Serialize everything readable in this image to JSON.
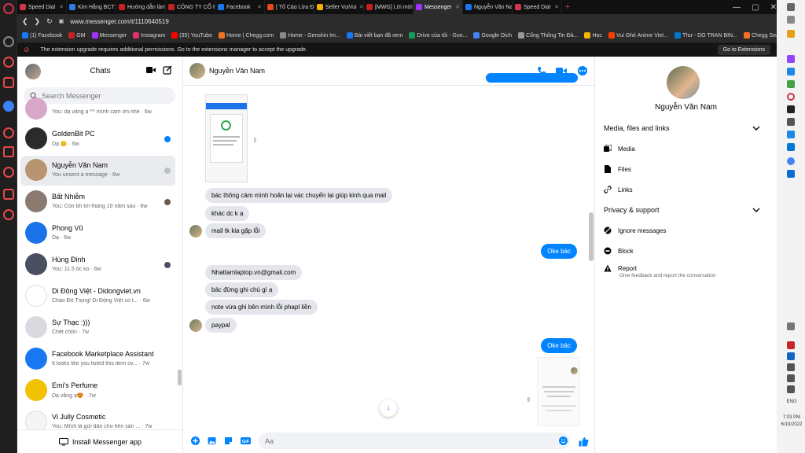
{
  "browser": {
    "tabs": [
      {
        "title": "Speed Dial",
        "color": "#d0354a"
      },
      {
        "title": "Kim Hằng BCT1",
        "color": "#2d7be5"
      },
      {
        "title": "Hướng dẫn làm",
        "color": "#c5221f"
      },
      {
        "title": "CÔNG TY CỔ PH",
        "color": "#c5221f"
      },
      {
        "title": "Facebook",
        "color": "#1877f2"
      },
      {
        "title": "[ Tố Cáo Lừa Đả",
        "color": "#e64a19"
      },
      {
        "title": "Seller VuiVui",
        "color": "#f5b300"
      },
      {
        "title": "[MWG] Lời mời l",
        "color": "#c5221f"
      },
      {
        "title": "Messenger",
        "color": "#a033ff",
        "active": true
      },
      {
        "title": "Nguyễn Văn Na",
        "color": "#1877f2"
      },
      {
        "title": "Speed Dial",
        "color": "#d0354a"
      }
    ],
    "new_tab": "+",
    "url": "www.messenger.com/t/1110640519",
    "bookmarks": [
      {
        "label": "(1) Facebook",
        "color": "#1877f2"
      },
      {
        "label": "GM",
        "color": "#c5221f"
      },
      {
        "label": "Messenger",
        "color": "#a033ff"
      },
      {
        "label": "Instagram",
        "color": "#e1306c"
      },
      {
        "label": "(35) YouTube",
        "color": "#ff0000"
      },
      {
        "label": "Home | Chegg.com",
        "color": "#f47321"
      },
      {
        "label": "Home - Genshin Im...",
        "color": "#888888"
      },
      {
        "label": "Bài viết bạn đã xem",
        "color": "#1877f2"
      },
      {
        "label": "Drive của tôi - Goo...",
        "color": "#0f9d58"
      },
      {
        "label": "Google Dịch",
        "color": "#4285f4"
      },
      {
        "label": "Cổng Thông Tin Đà...",
        "color": "#999999"
      },
      {
        "label": "Học",
        "color": "#f5b300"
      },
      {
        "label": "Vui Ghé Anime Viet...",
        "color": "#ff3d00"
      },
      {
        "label": "Thư - DO TRAN BIN...",
        "color": "#0078d4"
      },
      {
        "label": "Chegg Search",
        "color": "#f47321"
      }
    ],
    "notice": "The extension upgrade requires additional permissions. Go to the extensions manager to accept the upgrade.",
    "notice_button": "Go to Extensions"
  },
  "chats": {
    "title": "Chats",
    "search_placeholder": "Search Messenger",
    "items": [
      {
        "name": "",
        "snippet": "You: dạ vâng ạ ^^ mình cảm ơn nhé · 6w",
        "avatar": "#d9a7c7"
      },
      {
        "name": "GoldenBit PC",
        "snippet": "Dạ 😊 · 6w",
        "avatar": "#2b2b2b",
        "status": "#0084ff"
      },
      {
        "name": "Nguyễn Văn Nam",
        "snippet": "You unsent a message · 6w",
        "avatar": "#b89470",
        "status": "#bcc0c4"
      },
      {
        "name": "Bất Nhiễm",
        "snippet": "You: Còn bh tới tháng 10 nằm sau · 6w",
        "avatar": "#8a7a70",
        "status": "#6b5a50"
      },
      {
        "name": "Phong Vũ",
        "snippet": "Dạ · 6w",
        "avatar": "#1a73e8"
      },
      {
        "name": "Hùng Đinh",
        "snippet": "You: 11.5 ốc ko · 6w",
        "avatar": "#4a5060",
        "status": "#4a5060"
      },
      {
        "name": "Di Động Việt - Didongviet.vn",
        "snippet": "Chào Đỗ Trọng! Di Động Việt có t... · 6w",
        "avatar": "#ffffff"
      },
      {
        "name": "Sự Thạc :)))",
        "snippet": "Chết chôn · 7w",
        "avatar": "#d8dadf"
      },
      {
        "name": "Facebook Marketplace Assistant",
        "snippet": "It looks like you listed this item ov... · 7w",
        "avatar": "#1877f2"
      },
      {
        "name": "Emi's Perfume",
        "snippet": "Dạ vâng ạ😍 · 7w",
        "avatar": "#f2c200"
      },
      {
        "name": "Vi Jully Cosmetic",
        "snippet": "You: Mình là gửi dân cho hên sàn ... · 7w",
        "avatar": "#f5f5f5"
      }
    ],
    "install_label": "Install Messenger app"
  },
  "conversation": {
    "name": "Nguyễn Văn Nam",
    "messages": [
      {
        "dir": "in",
        "text": "bác thông cảm mình hoãn lại vác chuyển lại giúp kinh qua mail"
      },
      {
        "dir": "in",
        "text": "khác dc k ạ"
      },
      {
        "dir": "in",
        "text": "mail tk kia gặp lỗi"
      },
      {
        "dir": "out",
        "text": "Oke bác"
      },
      {
        "dir": "in",
        "text": "Nhattamlaptop.vn@gmail.com"
      },
      {
        "dir": "in",
        "text": "bác đừng ghi chú gì ạ"
      },
      {
        "dir": "in",
        "text": "note vừa ghi bên mình lỗi phapl liền"
      },
      {
        "dir": "in",
        "text": "paypal"
      },
      {
        "dir": "out",
        "text": "Oke bác"
      }
    ],
    "composer_placeholder": "Aa",
    "accent": "#0084ff"
  },
  "info": {
    "name": "Nguyễn Văn Nam",
    "media_section": "Media, files and links",
    "media_items": [
      "Media",
      "Files",
      "Links"
    ],
    "privacy_section": "Privacy & support",
    "privacy_items": [
      "Ignore messages",
      "Block",
      "Report"
    ],
    "report_sub": "Give feedback and report the conversation"
  },
  "system": {
    "language": "ENG",
    "time": "7:03 PM",
    "date": "6/19/2022"
  }
}
